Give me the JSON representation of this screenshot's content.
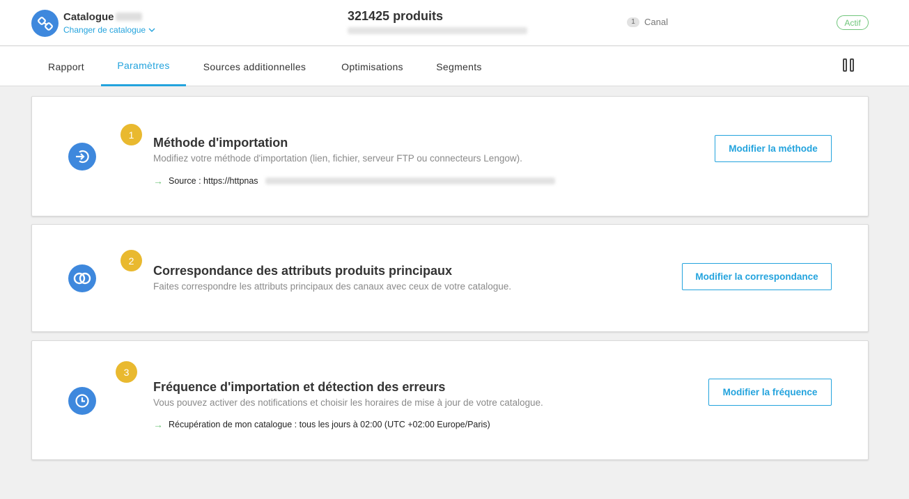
{
  "header": {
    "catalog_title": "Catalogue",
    "change_catalog_label": "Changer de catalogue",
    "products_count": "321425 produits",
    "channel_count": "1",
    "channel_label": "Canal",
    "status": "Actif"
  },
  "tabs": [
    {
      "label": "Rapport",
      "active": false
    },
    {
      "label": "Paramètres",
      "active": true
    },
    {
      "label": "Sources additionnelles",
      "active": false
    },
    {
      "label": "Optimisations",
      "active": false
    },
    {
      "label": "Segments",
      "active": false
    }
  ],
  "cards": [
    {
      "number": "1",
      "icon": "import-arrow-icon",
      "title": "Méthode d'importation",
      "description": "Modifiez votre méthode d'importation (lien, fichier, serveur FTP ou connecteurs Lengow).",
      "info": "Source : https://httpnas",
      "button": "Modifier la méthode"
    },
    {
      "number": "2",
      "icon": "linked-rings-icon",
      "title": "Correspondance des attributs produits principaux",
      "description": "Faites correspondre les attributs principaux des canaux avec ceux de votre catalogue.",
      "button": "Modifier la correspondance"
    },
    {
      "number": "3",
      "icon": "clock-icon",
      "title": "Fréquence d'importation et détection des erreurs",
      "description": "Vous pouvez activer des notifications et choisir les horaires de mise à jour de votre catalogue.",
      "info": "Récupération de mon catalogue : tous les jours à 02:00 (UTC +02:00 Europe/Paris)",
      "button": "Modifier la fréquence"
    }
  ],
  "colors": {
    "accent": "#23a3dd",
    "icon_blue": "#3e88dd",
    "badge_gold": "#e9b92f",
    "status_green": "#6fc57a"
  }
}
